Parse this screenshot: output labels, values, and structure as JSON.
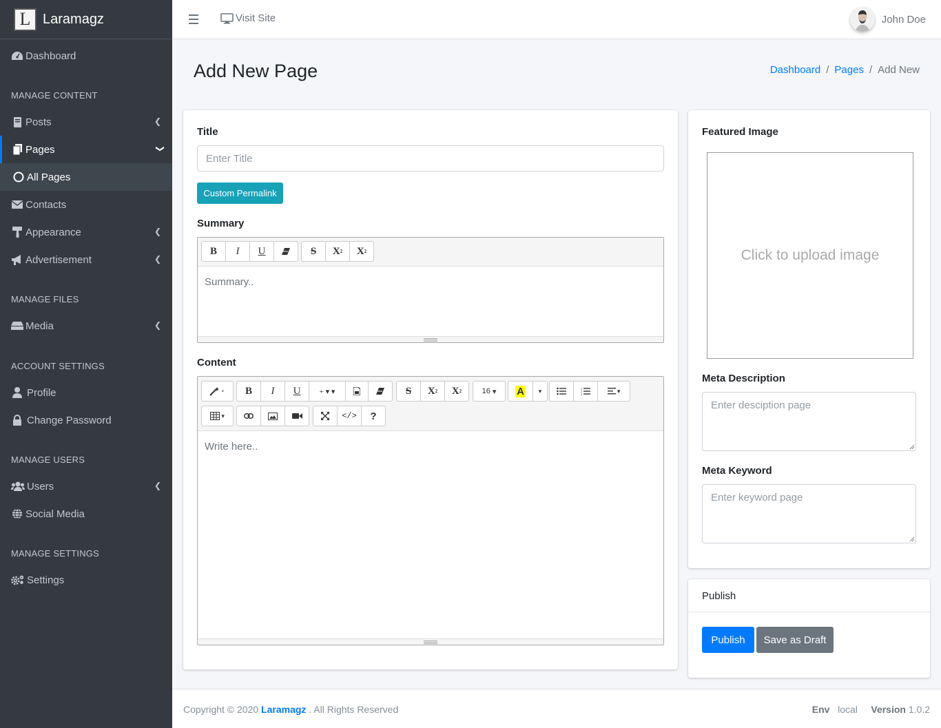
{
  "brand": {
    "logo_letter": "L",
    "name": "Laramagz"
  },
  "sidebar": {
    "dashboard": "Dashboard",
    "headers": {
      "manage_content": "MANAGE CONTENT",
      "manage_files": "MANAGE FILES",
      "account_settings": "ACCOUNT SETTINGS",
      "manage_users": "MANAGE USERS",
      "manage_settings": "MANAGE SETTINGS"
    },
    "items": {
      "posts": "Posts",
      "pages": "Pages",
      "all_pages": "All Pages",
      "contacts": "Contacts",
      "appearance": "Appearance",
      "advertisement": "Advertisement",
      "media": "Media",
      "profile": "Profile",
      "change_password": "Change Password",
      "users": "Users",
      "social_media": "Social Media",
      "settings": "Settings"
    }
  },
  "topbar": {
    "visit_site": "Visit Site",
    "user_name": "John Doe"
  },
  "page": {
    "title": "Add New Page",
    "breadcrumb": [
      "Dashboard",
      "Pages",
      "Add New"
    ]
  },
  "form": {
    "title_label": "Title",
    "title_placeholder": "Enter Title",
    "custom_permalink": "Custom Permalink",
    "summary_label": "Summary",
    "summary_placeholder": "Summary..",
    "content_label": "Content",
    "content_placeholder": "Write here..",
    "font_size": "16"
  },
  "side": {
    "featured_image_label": "Featured Image",
    "upload_text": "Click to upload image",
    "meta_description_label": "Meta Description",
    "meta_description_placeholder": "Enter desciption page",
    "meta_keyword_label": "Meta Keyword",
    "meta_keyword_placeholder": "Enter keyword page",
    "publish_header": "Publish",
    "publish_button": "Publish",
    "draft_button": "Save as Draft"
  },
  "footer": {
    "copyright_prefix": "Copyright © 2020",
    "brand": "Laramagz",
    "rights": ". All Rights Reserved",
    "env_label": "Env",
    "env_value": "local",
    "version_label": "Version",
    "version_value": "1.0.2"
  },
  "colors": {
    "sidebar_bg": "#343a40",
    "primary": "#007bff",
    "info": "#17a2b8",
    "secondary": "#6c757d"
  }
}
